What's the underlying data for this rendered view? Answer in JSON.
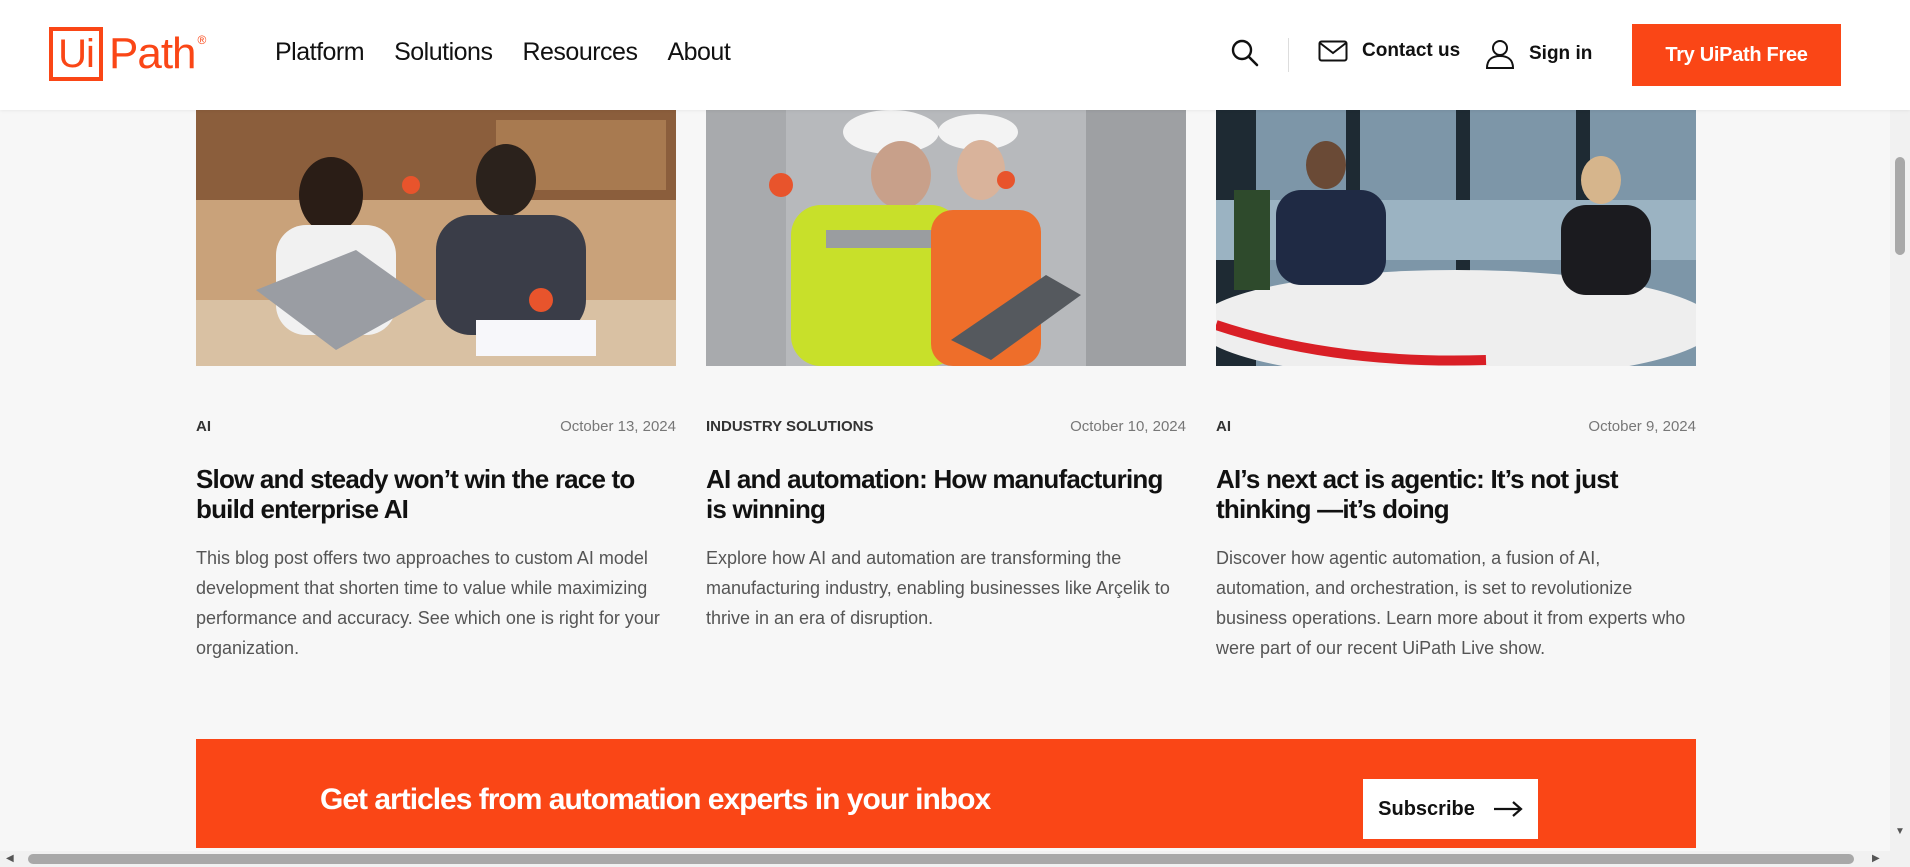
{
  "header": {
    "logo_ui": "Ui",
    "logo_rest": "Path",
    "logo_reg": "®",
    "nav": [
      "Platform",
      "Solutions",
      "Resources",
      "About"
    ],
    "contact_label": "Contact us",
    "signin_label": "Sign in",
    "cta_label": "Try UiPath Free"
  },
  "cards": [
    {
      "tag": "AI",
      "date": "October 13, 2024",
      "title": "Slow and steady won’t win the race to build enterprise AI",
      "description": "This blog post offers two approaches to custom AI model development that shorten time to value while maximizing performance and accuracy. See which one is right for your organization."
    },
    {
      "tag": "INDUSTRY SOLUTIONS",
      "date": "October 10, 2024",
      "title": "AI and automation: How manufacturing is winning",
      "description": "Explore how AI and automation are transforming the manufacturing industry, enabling businesses like Arçelik to thrive in an era of disruption."
    },
    {
      "tag": "AI",
      "date": "October 9, 2024",
      "title": "AI’s next act is agentic: It’s not just thinking —it’s doing",
      "description": "Discover how agentic automation, a fusion of AI, automation, and orchestration, is set to revolutionize business operations. Learn more about it from experts who were part of our recent UiPath Live show."
    }
  ],
  "banner": {
    "text": "Get articles from automation experts in your inbox",
    "button_label": "Subscribe"
  },
  "colors": {
    "brand": "#fa4616",
    "background": "#f7f7f7"
  }
}
